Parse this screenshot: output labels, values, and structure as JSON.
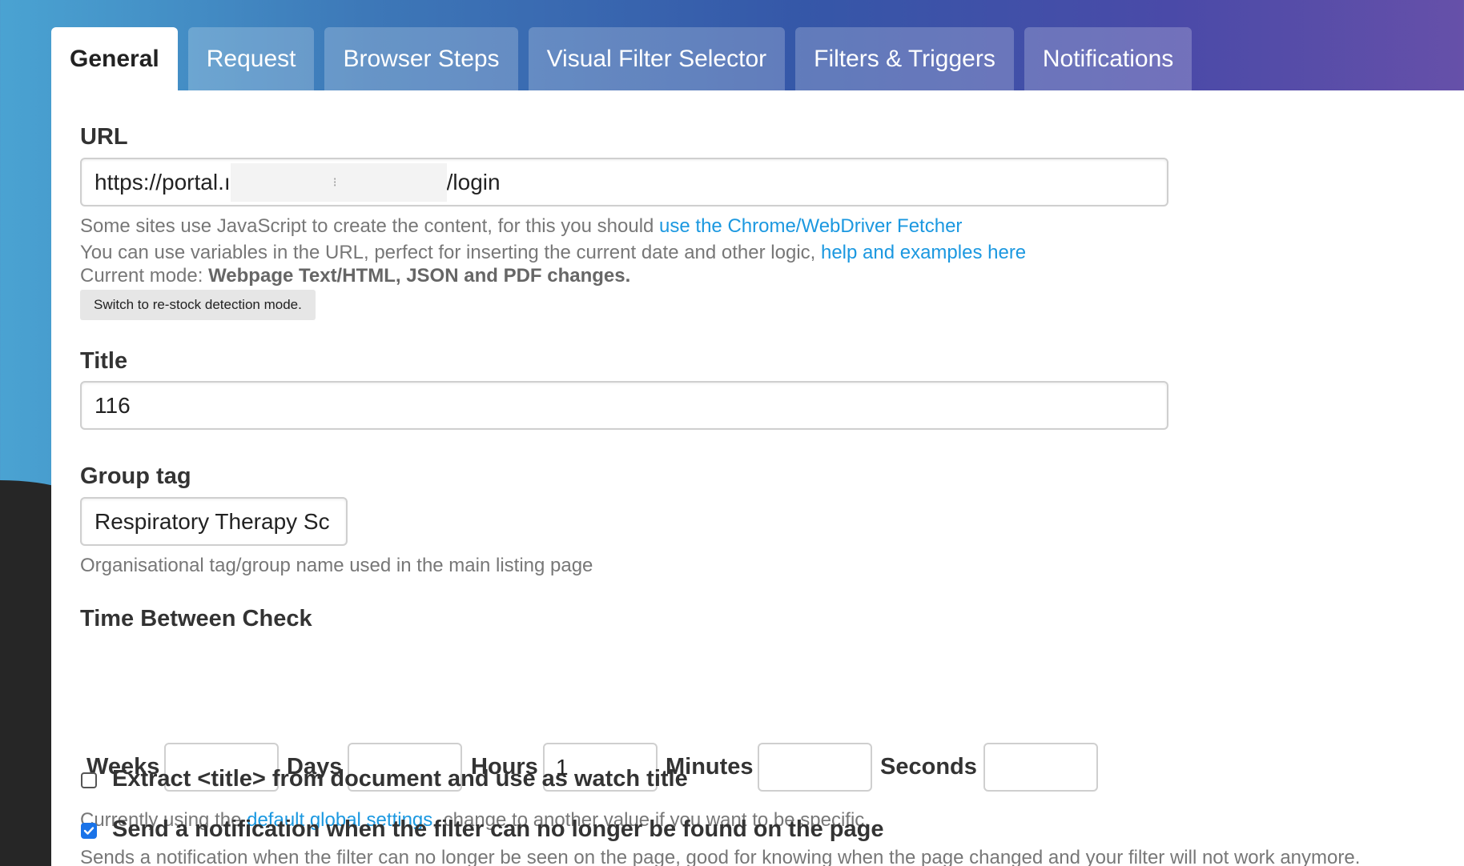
{
  "tabs": [
    {
      "label": "General",
      "active": true
    },
    {
      "label": "Request",
      "active": false
    },
    {
      "label": "Browser Steps",
      "active": false
    },
    {
      "label": "Visual Filter Selector",
      "active": false
    },
    {
      "label": "Filters & Triggers",
      "active": false
    },
    {
      "label": "Notifications",
      "active": false
    }
  ],
  "url": {
    "label": "URL",
    "value_prefix": "https://portal.ı",
    "value_mid": "⁝",
    "value_suffix": "/login",
    "help_line1_text": "Some sites use JavaScript to create the content, for this you should ",
    "help_line1_link": "use the Chrome/WebDriver Fetcher",
    "help_line2_text": "You can use variables in the URL, perfect for inserting the current date and other logic, ",
    "help_line2_link": "help and examples here",
    "mode_label": "Current mode: ",
    "mode_value": "Webpage Text/HTML, JSON and PDF changes.",
    "switch_button": "Switch to re-stock detection mode."
  },
  "title": {
    "label": "Title",
    "value": "116"
  },
  "group_tag": {
    "label": "Group tag",
    "value": "Respiratory Therapy Sc",
    "help": "Organisational tag/group name used in the main listing page"
  },
  "time_between_check": {
    "label": "Time Between Check",
    "weeks_label": "Weeks",
    "weeks_value": "",
    "days_label": "Days",
    "days_value": "",
    "hours_label": "Hours",
    "hours_value": "1",
    "minutes_label": "Minutes",
    "minutes_value": "",
    "seconds_label": "Seconds",
    "seconds_value": "",
    "help_prefix": "Currently using the ",
    "help_link": "default global settings",
    "help_suffix": ", change to another value if you want to be specific."
  },
  "extract_title": {
    "label": "Extract <title> from document and use as watch title",
    "checked": false
  },
  "filter_notification": {
    "label": "Send a notification when the filter can no longer be found on the page",
    "checked": true,
    "help": "Sends a notification when the filter can no longer be seen on the page, good for knowing when the page changed and your filter will not work anymore."
  },
  "colors": {
    "link": "#1b98e0",
    "checkbox_checked": "#1a73e8"
  }
}
